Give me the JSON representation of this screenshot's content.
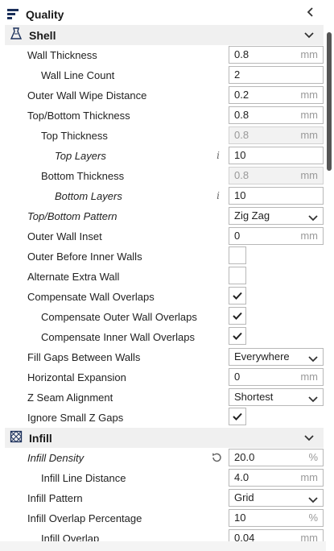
{
  "header": {
    "title": "Quality",
    "collapse_icon": "chevron-left-icon"
  },
  "sections": {
    "shell": {
      "title": "Shell",
      "icon": "shell-icon"
    },
    "infill": {
      "title": "Infill",
      "icon": "infill-icon"
    }
  },
  "settings": [
    {
      "label": "Wall Thickness",
      "value": "0.8",
      "unit": "mm"
    },
    {
      "label": "Wall Line Count",
      "value": "2"
    },
    {
      "label": "Outer Wall Wipe Distance",
      "value": "0.2",
      "unit": "mm"
    },
    {
      "label": "Top/Bottom Thickness",
      "value": "0.8",
      "unit": "mm"
    },
    {
      "label": "Top Thickness",
      "value": "0.8",
      "unit": "mm"
    },
    {
      "label": "Top Layers",
      "value": "10"
    },
    {
      "label": "Bottom Thickness",
      "value": "0.8",
      "unit": "mm"
    },
    {
      "label": "Bottom Layers",
      "value": "10"
    },
    {
      "label": "Top/Bottom Pattern",
      "value": "Zig Zag"
    },
    {
      "label": "Outer Wall Inset",
      "value": "0",
      "unit": "mm"
    },
    {
      "label": "Outer Before Inner Walls",
      "checked": false
    },
    {
      "label": "Alternate Extra Wall",
      "checked": false
    },
    {
      "label": "Compensate Wall Overlaps",
      "checked": true
    },
    {
      "label": "Compensate Outer Wall Overlaps",
      "checked": true
    },
    {
      "label": "Compensate Inner Wall Overlaps",
      "checked": true
    },
    {
      "label": "Fill Gaps Between Walls",
      "value": "Everywhere"
    },
    {
      "label": "Horizontal Expansion",
      "value": "0",
      "unit": "mm"
    },
    {
      "label": "Z Seam Alignment",
      "value": "Shortest"
    },
    {
      "label": "Ignore Small Z Gaps",
      "checked": true
    },
    {
      "label": "Infill Density",
      "value": "20.0",
      "unit": "%"
    },
    {
      "label": "Infill Line Distance",
      "value": "4.0",
      "unit": "mm"
    },
    {
      "label": "Infill Pattern",
      "value": "Grid"
    },
    {
      "label": "Infill Overlap Percentage",
      "value": "10",
      "unit": "%"
    },
    {
      "label": "Infill Overlap",
      "value": "0.04",
      "unit": "mm"
    }
  ]
}
